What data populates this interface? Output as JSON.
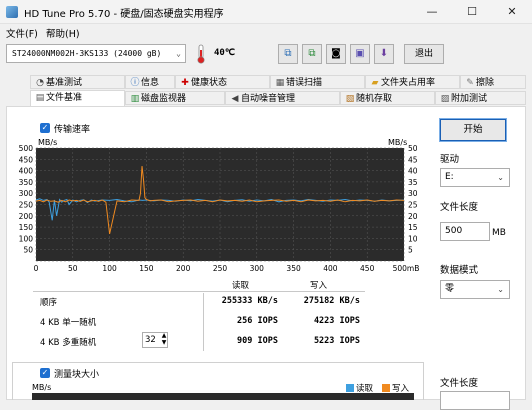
{
  "window": {
    "title": "HD Tune Pro 5.70 - 硬盘/固态硬盘实用程序",
    "minimize": "—",
    "maximize": "☐",
    "close": "✕"
  },
  "menu": {
    "file": "文件(F)",
    "help": "帮助(H)"
  },
  "toolbar": {
    "drive": "ST24000NM002H-3KS133 (24000 gB)",
    "temperature": "40℃",
    "exit_label": "退出"
  },
  "tabs_row1": [
    {
      "label": "基准测试",
      "icon": "gauge-icon"
    },
    {
      "label": "信息",
      "icon": "info-icon"
    },
    {
      "label": "健康状态",
      "icon": "health-cross-icon"
    },
    {
      "label": "错误扫描",
      "icon": "scan-icon"
    },
    {
      "label": "文件夹占用率",
      "icon": "folder-icon"
    },
    {
      "label": "擦除",
      "icon": "erase-icon"
    }
  ],
  "tabs_row2": [
    {
      "label": "文件基准",
      "icon": "file-icon"
    },
    {
      "label": "磁盘监视器",
      "icon": "monitor-icon"
    },
    {
      "label": "自动噪音管理",
      "icon": "speaker-icon"
    },
    {
      "label": "随机存取",
      "icon": "random-icon"
    },
    {
      "label": "附加测试",
      "icon": "extra-icon"
    }
  ],
  "transfer": {
    "checkbox_label": "传输速率"
  },
  "chart_data": {
    "type": "line",
    "title": "",
    "ylabel_left": "MB/s",
    "ylabel_right": "MB/s",
    "xlabel": "",
    "ylim": [
      0,
      500
    ],
    "xlim": [
      0,
      500
    ],
    "x_ticks": [
      "0",
      "50",
      "100",
      "150",
      "200",
      "250",
      "300",
      "350",
      "400",
      "450",
      "500mB"
    ],
    "y_ticks_left": [
      "500",
      "450",
      "400",
      "350",
      "300",
      "250",
      "200",
      "150",
      "100",
      "50"
    ],
    "y_ticks_right": [
      "50",
      "45",
      "40",
      "35",
      "30",
      "25",
      "20",
      "15",
      "10",
      "5"
    ],
    "grid": true,
    "series": [
      {
        "name": "读取",
        "color": "#3ea0e0",
        "x": [
          0,
          5,
          10,
          15,
          18,
          22,
          25,
          28,
          32,
          35,
          38,
          42,
          45,
          50,
          55,
          60,
          65,
          70,
          75,
          80,
          90,
          100,
          110,
          120,
          130,
          140,
          145,
          150,
          160,
          170,
          180,
          190,
          200,
          210,
          220,
          230,
          240,
          250,
          260,
          270,
          280,
          290,
          300,
          310,
          320,
          330,
          340,
          350,
          360,
          370,
          380,
          390,
          400,
          410,
          420,
          430,
          440,
          450,
          460,
          470,
          480,
          490,
          500
        ],
        "y": [
          270,
          275,
          268,
          272,
          260,
          180,
          270,
          200,
          272,
          260,
          268,
          272,
          250,
          270,
          262,
          268,
          271,
          259,
          270,
          265,
          270,
          268,
          272,
          266,
          262,
          270,
          268,
          270,
          266,
          270,
          268,
          264,
          270,
          266,
          272,
          268,
          265,
          270,
          262,
          268,
          271,
          264,
          270,
          266,
          272,
          262,
          268,
          270,
          266,
          272,
          268,
          264,
          270,
          268,
          272,
          266,
          270,
          268,
          264,
          270,
          266,
          268,
          270
        ]
      },
      {
        "name": "写入",
        "color": "#f08a20",
        "x": [
          0,
          5,
          10,
          15,
          20,
          25,
          30,
          35,
          40,
          45,
          50,
          55,
          60,
          65,
          70,
          75,
          80,
          85,
          90,
          95,
          100,
          110,
          120,
          130,
          140,
          142,
          144,
          146,
          148,
          150,
          155,
          160,
          170,
          180,
          190,
          200,
          210,
          220,
          230,
          240,
          250,
          260,
          270,
          280,
          290,
          300,
          310,
          320,
          330,
          340,
          350,
          360,
          370,
          380,
          390,
          400,
          410,
          420,
          430,
          440,
          450,
          460,
          470,
          480,
          490,
          500
        ],
        "y": [
          265,
          268,
          262,
          270,
          264,
          266,
          260,
          268,
          262,
          270,
          266,
          268,
          264,
          270,
          262,
          266,
          268,
          264,
          270,
          260,
          120,
          266,
          262,
          270,
          268,
          300,
          420,
          360,
          280,
          272,
          266,
          268,
          270,
          262,
          266,
          268,
          270,
          264,
          268,
          262,
          270,
          266,
          268,
          264,
          270,
          262,
          266,
          268,
          270,
          264,
          268,
          262,
          270,
          266,
          268,
          264,
          270,
          262,
          268,
          266,
          270,
          264,
          268,
          266,
          270,
          268
        ]
      }
    ]
  },
  "results": {
    "header_read": "读取",
    "header_write": "写入",
    "rows": [
      {
        "label": "顺序",
        "read": "255333 KB/s",
        "write": "275182 KB/s"
      },
      {
        "label": "4 KB 单一随机",
        "read": "256 IOPS",
        "write": "4223 IOPS"
      },
      {
        "label": "4 KB 多重随机",
        "read": "909 IOPS",
        "write": "5223 IOPS"
      }
    ],
    "queue_depth": "32"
  },
  "side": {
    "start_label": "开始",
    "drive_label": "驱动",
    "drive_value": "E:",
    "length_label": "文件长度",
    "length_value": "500",
    "length_unit": "MB",
    "pattern_label": "数据模式",
    "pattern_value": "零",
    "length_label2": "文件长度"
  },
  "block": {
    "checkbox_label": "测量块大小",
    "ylabel": "MB/s",
    "legend_read": "读取",
    "legend_write": "写入"
  }
}
